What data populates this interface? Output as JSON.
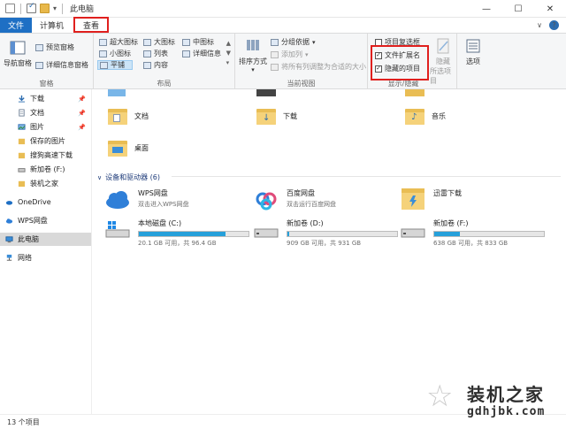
{
  "window": {
    "title": "此电脑",
    "minimize": "—",
    "maximize": "☐",
    "close": "✕"
  },
  "tabs": [
    {
      "label": "文件"
    },
    {
      "label": "计算机"
    },
    {
      "label": "查看"
    }
  ],
  "ribbon": {
    "pane": {
      "nav_pane": "导航窗格",
      "preview_pane": "预览窗格",
      "details_pane": "详细信息窗格",
      "group_label": "窗格"
    },
    "layout": {
      "items": [
        "超大图标",
        "大图标",
        "中图标",
        "小图标",
        "列表",
        "详细信息",
        "平铺",
        "内容"
      ],
      "group_label": "布局"
    },
    "current_view": {
      "sort_by": "排序方式",
      "group_by": "分组依据",
      "add_column": "添加列",
      "fit_columns": "将所有列调整为合适的大小",
      "group_label": "当前视图"
    },
    "show_hide": {
      "item_checkboxes": "项目复选框",
      "file_extensions": "文件扩展名",
      "hidden_items": "隐藏的项目",
      "hide_selected": "隐藏",
      "hide_selected_2": "所选项目",
      "options": "选项",
      "group_label": "显示/隐藏"
    }
  },
  "nav": {
    "items": [
      {
        "label": "下载",
        "pinned": true
      },
      {
        "label": "文档",
        "pinned": true
      },
      {
        "label": "图片",
        "pinned": true
      },
      {
        "label": "保存的图片",
        "pinned": false
      },
      {
        "label": "搜狗高速下载",
        "pinned": false
      },
      {
        "label": "新加卷 (F:)",
        "pinned": false
      },
      {
        "label": "装机之家",
        "pinned": false
      },
      {
        "label": "OneDrive",
        "pinned": false
      },
      {
        "label": "WPS网盘",
        "pinned": false
      },
      {
        "label": "此电脑",
        "pinned": false
      },
      {
        "label": "网络",
        "pinned": false
      }
    ]
  },
  "folders": [
    {
      "label": "文档"
    },
    {
      "label": "下载"
    },
    {
      "label": "音乐"
    },
    {
      "label": "桌面"
    }
  ],
  "devices_section": "设备和驱动器 (6)",
  "devices": [
    {
      "name": "WPS网盘",
      "sub": "双击进入WPS网盘"
    },
    {
      "name": "百度网盘",
      "sub": "双击运行百度网盘"
    },
    {
      "name": "迅雷下载",
      "sub": ""
    },
    {
      "name": "本地磁盘 (C:)",
      "sub": "20.1 GB 可用，共 96.4 GB",
      "used_fraction": 0.79
    },
    {
      "name": "新加卷 (D:)",
      "sub": "909 GB 可用，共 931 GB",
      "used_fraction": 0.02
    },
    {
      "name": "新加卷 (F:)",
      "sub": "638 GB 可用，共 833 GB",
      "used_fraction": 0.23
    }
  ],
  "status": {
    "text": "13 个项目"
  },
  "watermark": {
    "title": "装机之家",
    "url": "gdhjbk.com"
  }
}
